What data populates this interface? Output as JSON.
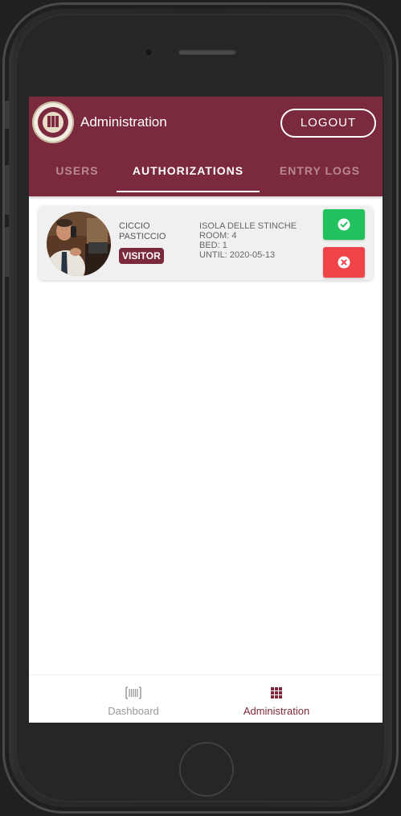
{
  "app": {
    "title": "Administration",
    "logout_label": "LOGOUT",
    "accent_color": "#7b2a3d"
  },
  "tabs": [
    {
      "label": "USERS",
      "active": false
    },
    {
      "label": "AUTHORIZATIONS",
      "active": true
    },
    {
      "label": "ENTRY LOGS",
      "active": false
    }
  ],
  "authorization": {
    "first_name": "CICCIO",
    "last_name": "PASTICCIO",
    "role_badge": "VISITOR",
    "facility": "ISOLA DELLE STINCHE",
    "room": "ROOM: 4",
    "bed": "BED: 1",
    "until": "UNTIL: 2020-05-13",
    "approve_icon": "check-circle-icon",
    "reject_icon": "x-circle-icon",
    "approve_color": "#21c25e",
    "reject_color": "#f1434a"
  },
  "bottom_nav": [
    {
      "label": "Dashboard",
      "icon": "barcode-icon",
      "active": false
    },
    {
      "label": "Administration",
      "icon": "grid-icon",
      "active": true
    }
  ]
}
